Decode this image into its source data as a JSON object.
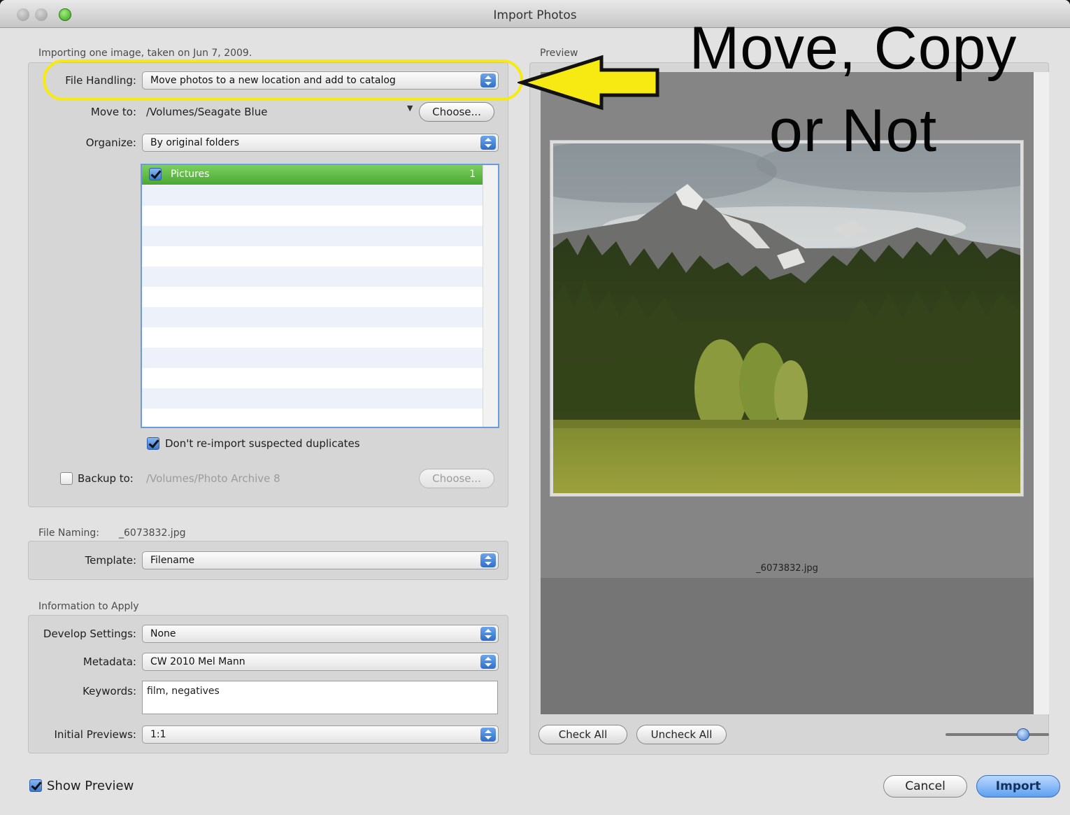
{
  "window": {
    "title": "Import Photos"
  },
  "overlay": {
    "title": "Move, Copy\nor Not"
  },
  "import_summary": "Importing one image, taken on Jun 7, 2009.",
  "preview_label": "Preview",
  "file_handling": {
    "label": "File Handling:",
    "value": "Move photos to a new location and add to catalog"
  },
  "move_to": {
    "label": "Move to:",
    "path": "/Volumes/Seagate Blue",
    "choose_label": "Choose..."
  },
  "organize": {
    "label": "Organize:",
    "value": "By original folders"
  },
  "folders": [
    {
      "name": "Pictures",
      "count": "1",
      "checked": true
    }
  ],
  "duplicates": {
    "label": "Don't re-import suspected duplicates",
    "checked": true
  },
  "backup": {
    "label": "Backup to:",
    "path": "/Volumes/Photo Archive 8",
    "choose_label": "Choose...",
    "checked": false
  },
  "file_naming": {
    "label": "File Naming:",
    "example": "_6073832.jpg",
    "template_label": "Template:",
    "template_value": "Filename"
  },
  "info_to_apply": {
    "label": "Information to Apply",
    "develop_label": "Develop Settings:",
    "develop_value": "None",
    "metadata_label": "Metadata:",
    "metadata_value": "CW 2010 Mel Mann",
    "keywords_label": "Keywords:",
    "keywords_value": "film, negatives",
    "previews_label": "Initial Previews:",
    "previews_value": "1:1"
  },
  "preview": {
    "caption": "_6073832.jpg",
    "check_all_label": "Check All",
    "uncheck_all_label": "Uncheck All",
    "thumb_size": 0.75
  },
  "footer": {
    "show_preview_label": "Show Preview",
    "show_preview_checked": true,
    "cancel_label": "Cancel",
    "import_label": "Import"
  },
  "colors": {
    "highlight": "#f6ea12",
    "selected_folder": "#4aa832",
    "accent": "#3a78d0"
  },
  "icons": [
    "window-close-icon",
    "window-minimize-icon",
    "window-zoom-icon",
    "popup-arrows-icon",
    "checkmark-icon",
    "pointer-arrow-icon"
  ]
}
